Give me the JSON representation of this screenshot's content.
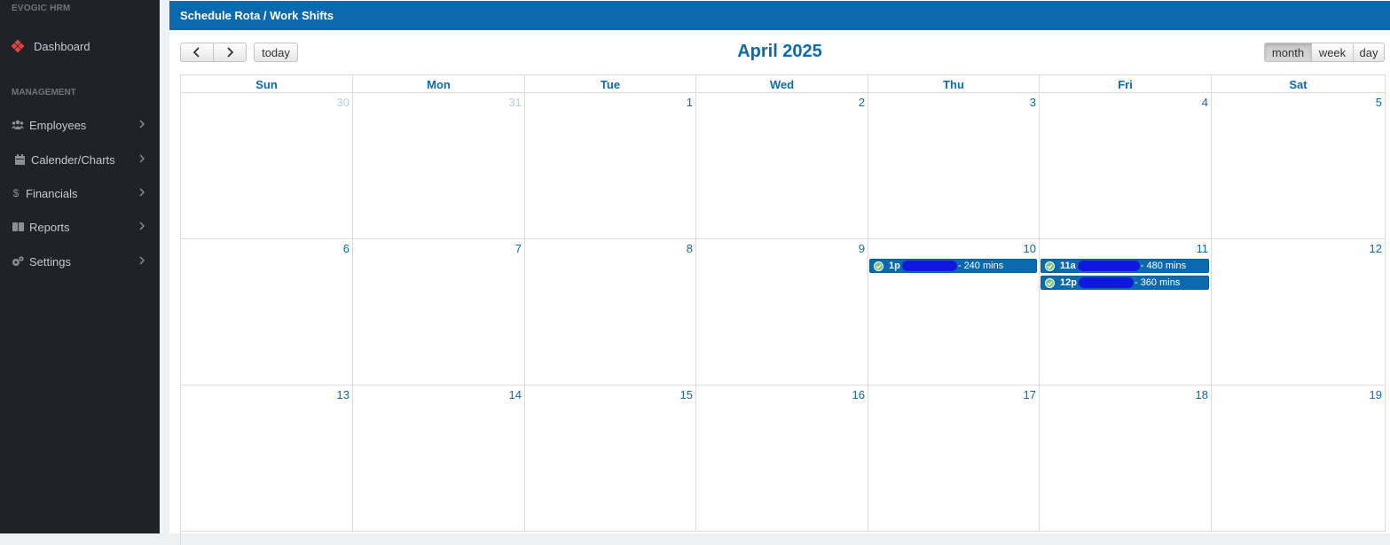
{
  "app": {
    "brand": "EVOGIC HRM"
  },
  "sidebar": {
    "dashboard_label": "Dashboard",
    "section_label": "MANAGEMENT",
    "items": [
      {
        "label": "Employees",
        "icon": "users-icon"
      },
      {
        "label": "Calender/Charts",
        "icon": "calendar-icon"
      },
      {
        "label": "Financials",
        "icon": "dollar-icon"
      },
      {
        "label": "Reports",
        "icon": "book-icon"
      },
      {
        "label": "Settings",
        "icon": "gears-icon"
      }
    ]
  },
  "page": {
    "title": "Schedule Rota / Work Shifts"
  },
  "toolbar": {
    "prev_icon": "chevron-left-icon",
    "next_icon": "chevron-right-icon",
    "today_label": "today",
    "views": [
      "month",
      "week",
      "day"
    ],
    "active_view": "month"
  },
  "calendar": {
    "title": "April 2025",
    "days_of_week": [
      "Sun",
      "Mon",
      "Tue",
      "Wed",
      "Thu",
      "Fri",
      "Sat"
    ],
    "weeks": [
      [
        "30",
        "31",
        "1",
        "2",
        "3",
        "4",
        "5"
      ],
      [
        "6",
        "7",
        "8",
        "9",
        "10",
        "11",
        "12"
      ],
      [
        "13",
        "14",
        "15",
        "16",
        "17",
        "18",
        "19"
      ]
    ],
    "other_month_days": [
      "30",
      "31"
    ],
    "events": [
      {
        "day": "10",
        "time": "1p",
        "duration": "- 240 mins"
      },
      {
        "day": "11",
        "time": "11a",
        "duration": "- 480 mins"
      },
      {
        "day": "11",
        "time": "12p",
        "duration": "- 360 mins"
      }
    ]
  },
  "colors": {
    "brand_blue": "#0b69ad",
    "sidebar_bg": "#1f2327",
    "dashboard_icon": "#e0453d",
    "event_check": "#7cc576"
  }
}
